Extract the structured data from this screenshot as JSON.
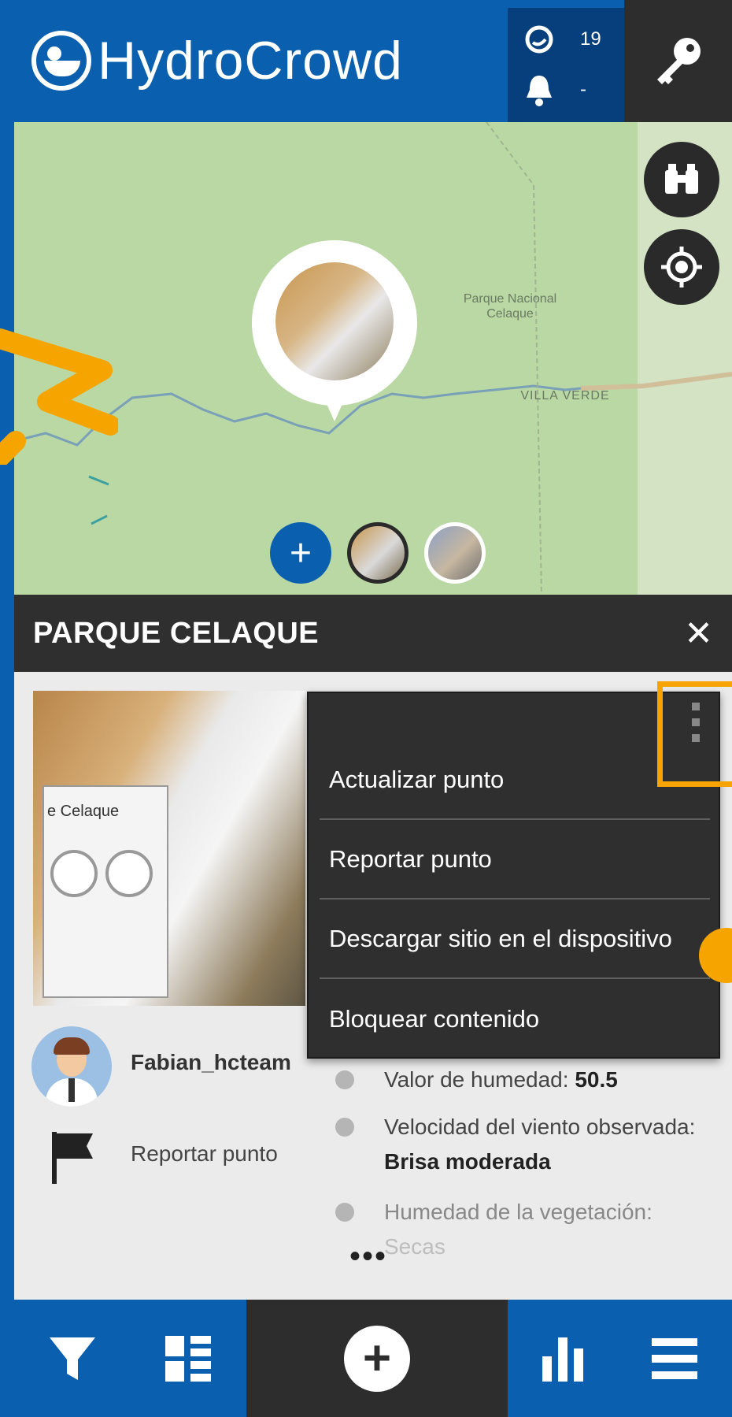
{
  "app": {
    "name": "HydroCrowd"
  },
  "header": {
    "points_count": "19",
    "notifications_count": "-"
  },
  "map": {
    "park_label": "Parque Nacional Celaque",
    "town_label": "VILLA VERDE"
  },
  "site": {
    "title": "PARQUE CELAQUE",
    "username": "Fabian_hcteam",
    "report_label": "Reportar punto",
    "attributes": [
      {
        "label": "Valor de humedad:",
        "value": "50.5"
      },
      {
        "label": "Velocidad del viento observada:",
        "value": "Brisa moderada"
      },
      {
        "label": "Humedad de la vegetación:",
        "value": "Secas"
      }
    ],
    "more": "•••",
    "photo_text": "e Celaque"
  },
  "menu": {
    "items": [
      "Actualizar punto",
      "Reportar punto",
      "Descargar sitio en el dispositivo",
      "Bloquear contenido"
    ]
  },
  "icons": {
    "header": [
      "droplet-icon",
      "bell-icon",
      "key-icon"
    ],
    "map": [
      "binoculars-icon",
      "locate-icon"
    ],
    "bottom": [
      "filter-icon",
      "list-icon",
      "add-icon",
      "chart-icon",
      "menu-icon"
    ]
  },
  "colors": {
    "primary_blue": "#0a5fae",
    "dark": "#2d2d2d",
    "highlight_orange": "#f6a500",
    "map_green": "#b9d8a4"
  }
}
